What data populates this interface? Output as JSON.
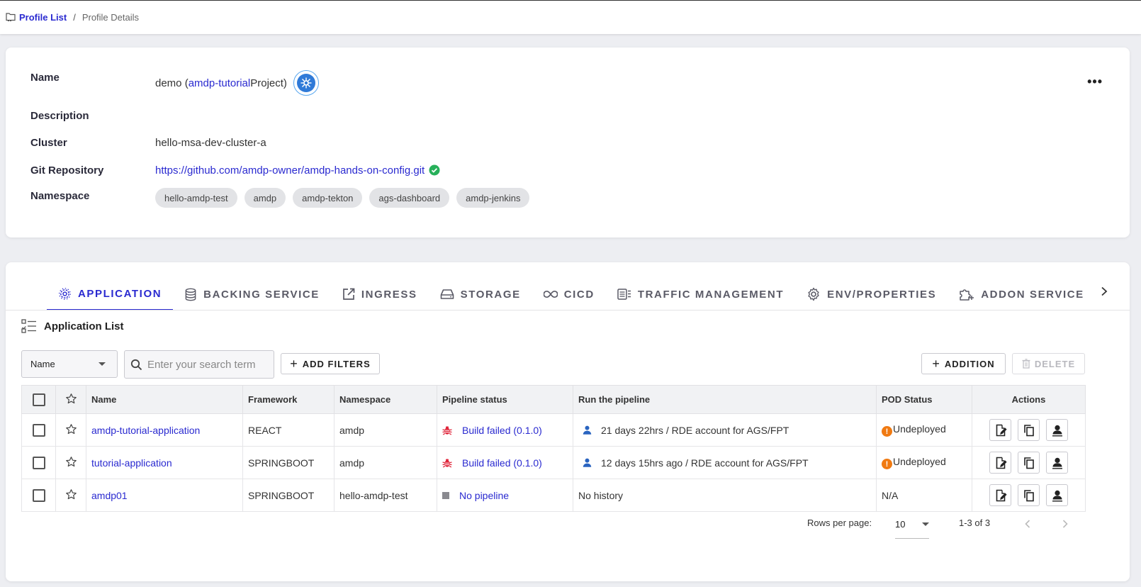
{
  "breadcrumb": {
    "root": "Profile List",
    "separator": "/",
    "current": "Profile Details"
  },
  "profile": {
    "labels": {
      "name": "Name",
      "description": "Description",
      "cluster": "Cluster",
      "git": "Git Repository",
      "namespace": "Namespace"
    },
    "name_prefix": "demo (",
    "name_project_link": "amdp-tutorial",
    "name_suffix": "Project)",
    "description": "",
    "cluster": "hello-msa-dev-cluster-a",
    "git_url": "https://github.com/amdp-owner/amdp-hands-on-config.git",
    "namespaces": [
      "hello-amdp-test",
      "amdp",
      "amdp-tekton",
      "ags-dashboard",
      "amdp-jenkins"
    ],
    "more_label": "•••"
  },
  "tabs": [
    {
      "label": "APPLICATION",
      "icon": "cog-icon",
      "active": true
    },
    {
      "label": "BACKING SERVICE",
      "icon": "database-icon"
    },
    {
      "label": "INGRESS",
      "icon": "external-link-icon"
    },
    {
      "label": "STORAGE",
      "icon": "storage-icon"
    },
    {
      "label": "CICD",
      "icon": "infinity-icon"
    },
    {
      "label": "TRAFFIC MANAGEMENT",
      "icon": "traffic-icon"
    },
    {
      "label": "ENV/PROPERTIES",
      "icon": "settings-icon"
    },
    {
      "label": "ADDON SERVICE",
      "icon": "puzzle-icon"
    }
  ],
  "app_list": {
    "title": "Application List",
    "filter_field": "Name",
    "search_placeholder": "Enter your search term",
    "add_filters_label": "ADD FILTERS",
    "addition_label": "ADDITION",
    "delete_label": "DELETE",
    "columns": [
      "Name",
      "Framework",
      "Namespace",
      "Pipeline status",
      "Run the pipeline",
      "POD Status",
      "Actions"
    ],
    "rows": [
      {
        "name": "amdp-tutorial-application",
        "framework": "REACT",
        "namespace": "amdp",
        "pipeline_status": "Build failed (0.1.0)",
        "pipeline_kind": "failed",
        "run": "21 days 22hrs / RDE account for AGS/FPT",
        "run_has_user": true,
        "pod_status": "Undeployed",
        "pod_warn": true
      },
      {
        "name": "tutorial-application",
        "framework": "SPRINGBOOT",
        "namespace": "amdp",
        "pipeline_status": "Build failed (0.1.0)",
        "pipeline_kind": "failed",
        "run": "12 days 15hrs ago / RDE account for AGS/FPT",
        "run_has_user": true,
        "pod_status": "Undeployed",
        "pod_warn": true
      },
      {
        "name": "amdp01",
        "framework": "SPRINGBOOT",
        "namespace": "hello-amdp-test",
        "pipeline_status": "No pipeline",
        "pipeline_kind": "none",
        "run": "No history",
        "run_has_user": false,
        "pod_status": "N/A",
        "pod_warn": false
      }
    ]
  },
  "pagination": {
    "rows_per_page_label": "Rows per page:",
    "rows_per_page": "10",
    "range": "1-3 of 3"
  },
  "colors": {
    "accent": "#2a2ad0",
    "error": "#e0253a",
    "warning": "#f07a12",
    "success": "#27b05a"
  }
}
